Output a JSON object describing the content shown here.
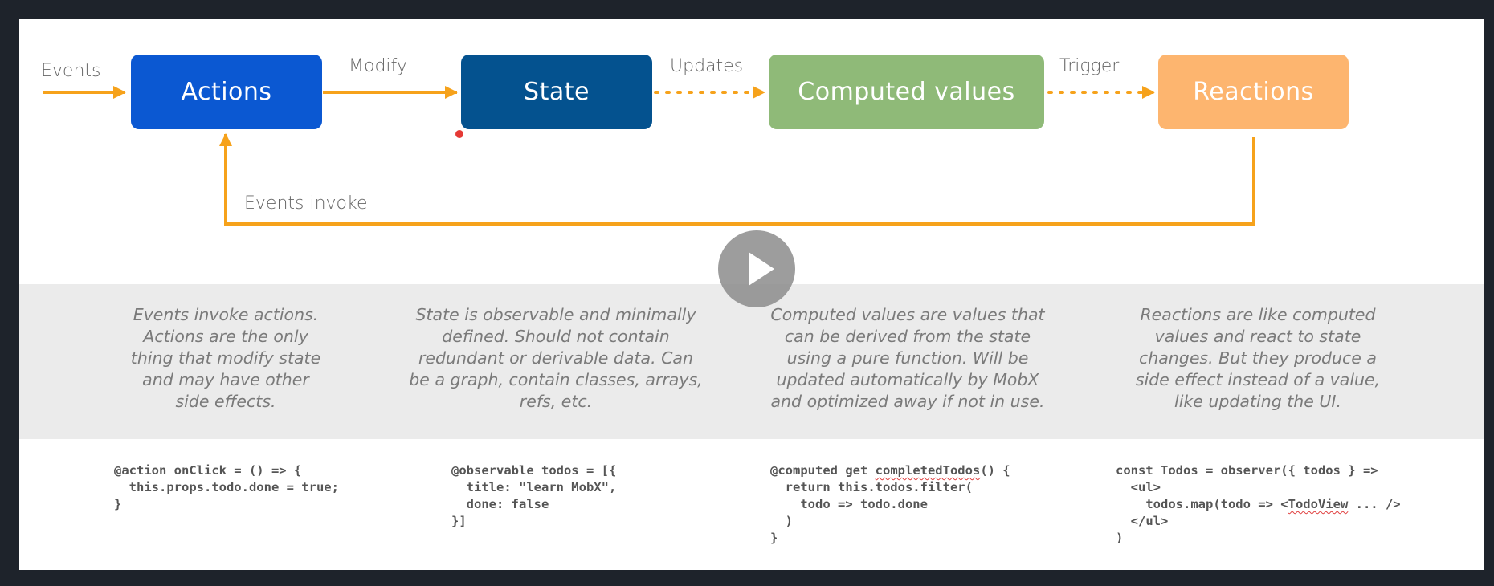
{
  "colors": {
    "actions": "#0b58d2",
    "state": "#04528f",
    "computed": "#8fba78",
    "reactions": "#fdb56f",
    "arrow": "#f6a21b"
  },
  "diagram": {
    "nodes": {
      "actions": "Actions",
      "state": "State",
      "computed": "Computed values",
      "reactions": "Reactions"
    },
    "edges": {
      "events": "Events",
      "modify": "Modify",
      "updates": "Updates",
      "trigger": "Trigger",
      "events_invoke": "Events invoke"
    }
  },
  "descriptions": {
    "actions": "Events invoke actions.\nActions are the only\nthing that modify state\nand may have other\nside effects.",
    "state": "State is observable and minimally\ndefined. Should not contain\nredundant or derivable data. Can\nbe a graph, contain classes, arrays,\nrefs, etc.",
    "computed": "Computed values are values that\ncan be derived from the state\nusing a pure function. Will be\nupdated automatically by MobX\nand optimized away if not in use.",
    "reactions": "Reactions are like computed\nvalues and react to state\nchanges. But they produce a\nside effect instead of a value,\nlike updating the UI."
  },
  "code": {
    "actions": [
      "@action onClick = () => {",
      "  this.props.todo.done = true;",
      "}"
    ],
    "state": [
      "@observable todos = [{",
      "  title: \"learn MobX\",",
      "  done: false",
      "}]"
    ],
    "computed": [
      "@computed get completedTodos() {",
      "  return this.todos.filter(",
      "    todo => todo.done",
      "  )",
      "}"
    ],
    "reactions": [
      "const Todos = observer({ todos } =>",
      "  <ul>",
      "    todos.map(todo => <TodoView ... />",
      "  </ul>",
      ")"
    ]
  },
  "video": {
    "play_icon": "play-icon"
  }
}
